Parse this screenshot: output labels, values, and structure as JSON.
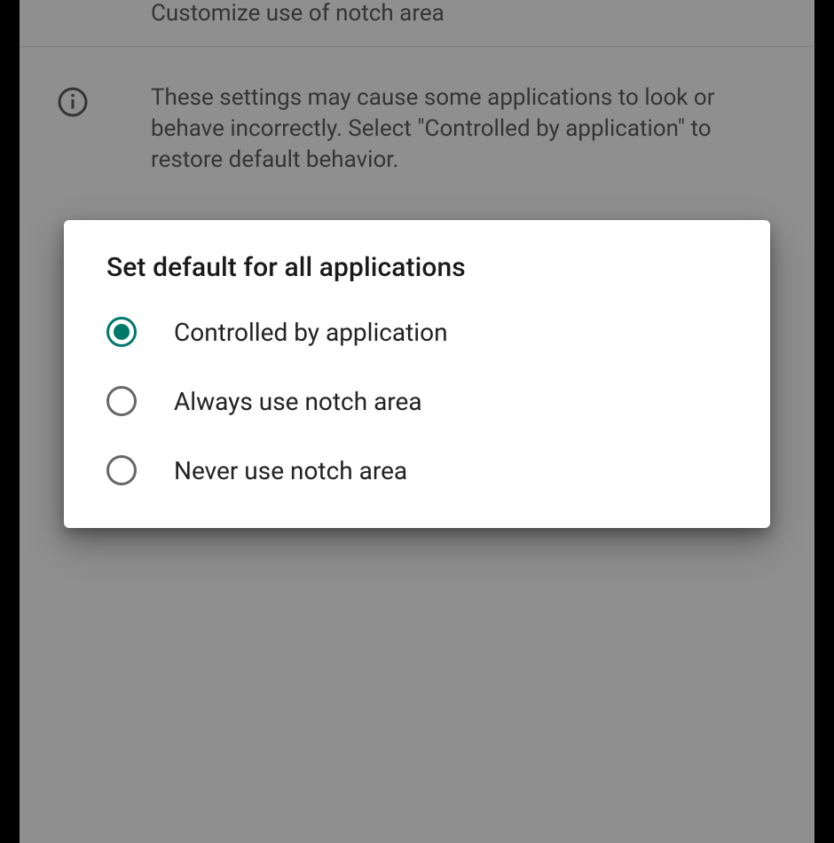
{
  "colors": {
    "accent": "#00796b"
  },
  "settings": {
    "header_subtitle": "Customize use of notch area",
    "info_text": "These settings may cause some applications to look or behave incorrectly. Select \"Controlled by application\" to restore default behavior."
  },
  "dialog": {
    "title": "Set default for all applications",
    "options": [
      {
        "label": "Controlled by application",
        "selected": true
      },
      {
        "label": "Always use notch area",
        "selected": false
      },
      {
        "label": "Never use notch area",
        "selected": false
      }
    ]
  }
}
